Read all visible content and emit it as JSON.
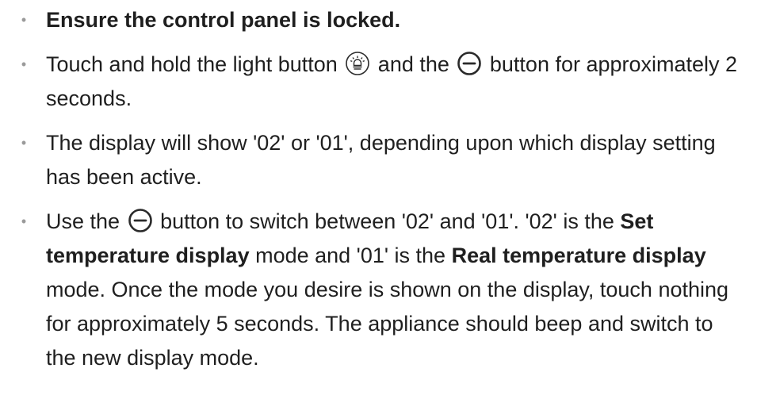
{
  "steps": [
    {
      "text": "Ensure the control panel is locked."
    },
    {
      "t1": "Touch and hold the light button ",
      "icon1": "light-bulb-icon",
      "t2": " and the ",
      "icon2": "minus-circle-icon",
      "t3": " button for approximately 2 seconds."
    },
    {
      "text": "The display will show '02' or '01', depending upon which display setting has been active."
    },
    {
      "t1": "Use the ",
      "icon1": "minus-circle-icon",
      "t2": " button to switch between '02' and '01'. '02' is the ",
      "b1": "Set temperature display",
      "t3": " mode and '01' is the ",
      "b2": "Real temperature display",
      "t4": " mode. Once the mode you desire is shown on the display, touch nothing for approximately 5 seconds. The appliance should beep and switch to the new display mode."
    }
  ],
  "bullet_glyph": "•",
  "colors": {
    "text": "#1f1f1f",
    "bullet": "#9a9a9a",
    "icon_stroke": "#2a2a2a"
  }
}
